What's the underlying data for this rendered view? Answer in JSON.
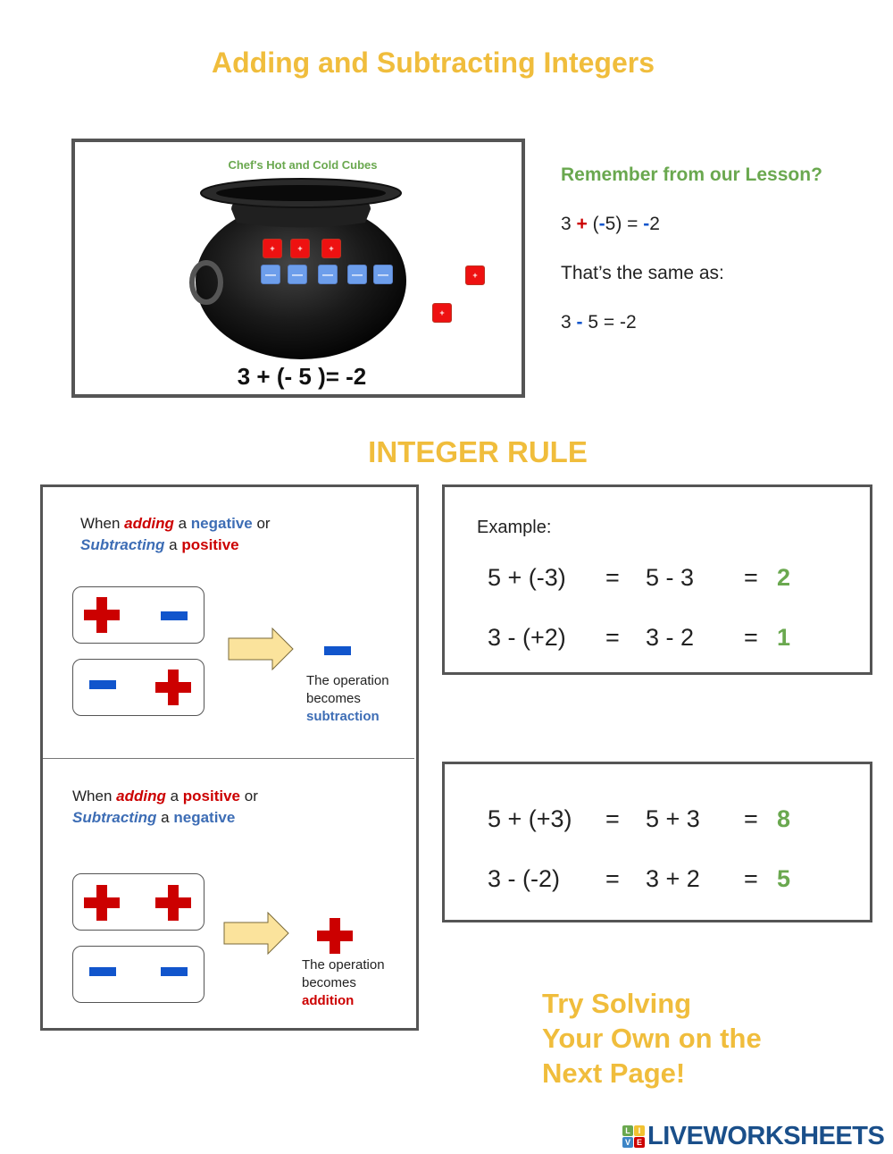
{
  "title": "Adding and Subtracting Integers",
  "cauldron": {
    "caption": "Chef's Hot and Cold Cubes",
    "hot_cubes_in_pot": 3,
    "cold_cubes_in_pot": 5,
    "hot_cubes_outside": 2,
    "hot_symbol": "+",
    "cold_symbol": "—",
    "equation": "3 + (- 5 )= -2"
  },
  "reminder": {
    "heading": "Remember from our Lesson?",
    "eq1": {
      "a": "3",
      "op": "+",
      "open": "(",
      "neg": "-",
      "b": "5) = ",
      "res_sign": "-",
      "res": "2"
    },
    "same_as": "That’s the same as:",
    "eq2": {
      "a": "3",
      "op": "-",
      "rest": "5  = -2"
    }
  },
  "section_heading": "INTEGER RULE",
  "rule_subtraction": {
    "line1": {
      "w1": "When ",
      "w2": "adding",
      "w3": " a ",
      "w4": "negative",
      "w5": " or"
    },
    "line2": {
      "w1": "Subtracting",
      "w2": " a ",
      "w3": "positive"
    },
    "result_line1": "The operation",
    "result_line2": "becomes",
    "result_word": "subtraction"
  },
  "rule_addition": {
    "line1": {
      "w1": "When ",
      "w2": "adding",
      "w3": " a ",
      "w4": "positive",
      "w5": " or"
    },
    "line2": {
      "w1": "Subtracting",
      "w2": " a ",
      "w3": "negative"
    },
    "result_line1": "The operation",
    "result_line2": "becomes",
    "result_word": "addition"
  },
  "examples": {
    "label": "Example:",
    "rows": [
      {
        "expr": "5 + (-3)",
        "eq1": "=",
        "simplified": "5 - 3",
        "eq2": "=",
        "answer": "2"
      },
      {
        "expr": "3 - (+2)",
        "eq1": "=",
        "simplified": "3 - 2",
        "eq2": "=",
        "answer": "1"
      }
    ]
  },
  "examples2": {
    "rows": [
      {
        "expr": "5 + (+3)",
        "eq1": "=",
        "simplified": "5 + 3",
        "eq2": "=",
        "answer": "8"
      },
      {
        "expr": "3 - (-2)",
        "eq1": "=",
        "simplified": "3 + 2",
        "eq2": "=",
        "answer": "5"
      }
    ]
  },
  "try_text": {
    "line1": "Try Solving",
    "line2": "Your Own on the",
    "line3": "Next Page!"
  },
  "logo": {
    "blocks": [
      "L",
      "I",
      "V",
      "E"
    ],
    "text": "LIVEWORKSHEETS"
  },
  "colors": {
    "title_gold": "#f0bd3c",
    "green": "#6aa84f",
    "red": "#cc0000",
    "blue": "#1155cc"
  }
}
